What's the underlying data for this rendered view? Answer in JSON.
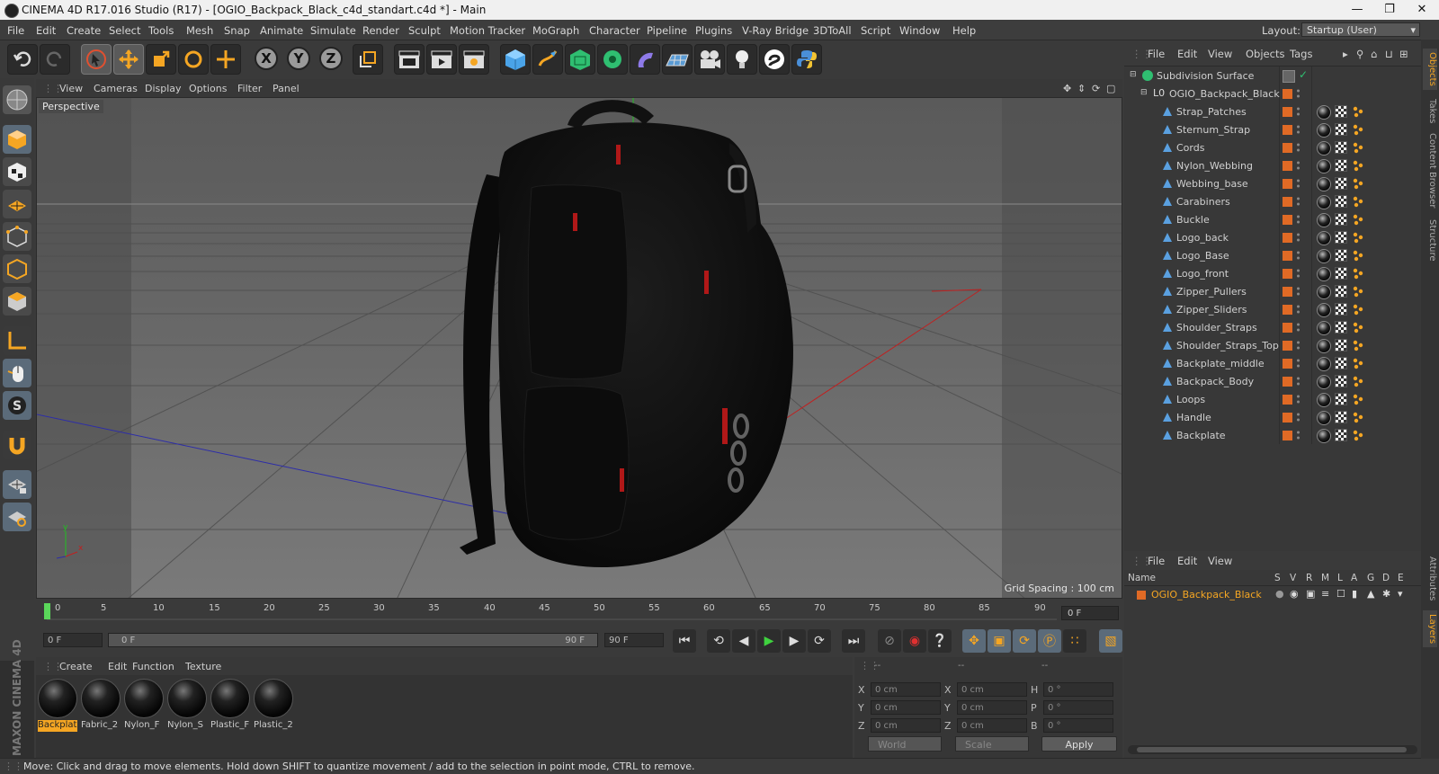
{
  "window": {
    "title": "CINEMA 4D R17.016 Studio (R17) - [OGIO_Backpack_Black_c4d_standart.c4d *] - Main",
    "buttons": [
      "—",
      "❐",
      "✕"
    ]
  },
  "menubar": {
    "items": [
      "File",
      "Edit",
      "Create",
      "Select",
      "Tools",
      "Mesh",
      "Snap",
      "Animate",
      "Simulate",
      "Render",
      "Sculpt",
      "Motion Tracker",
      "MoGraph",
      "Character",
      "Pipeline",
      "Plugins",
      "V-Ray Bridge",
      "3DToAll",
      "Script",
      "Window",
      "Help"
    ],
    "layout_label": "Layout:",
    "layout_value": "Startup (User)"
  },
  "toolbar": {
    "axes": [
      "X",
      "Y",
      "Z"
    ]
  },
  "viewport": {
    "menu": [
      "View",
      "Cameras",
      "Display",
      "Options",
      "Filter",
      "Panel"
    ],
    "camera_label": "Perspective",
    "grid_spacing": "Grid Spacing : 100 cm"
  },
  "timeline": {
    "ticks": [
      "0",
      "5",
      "10",
      "15",
      "20",
      "25",
      "30",
      "35",
      "40",
      "45",
      "50",
      "55",
      "60",
      "65",
      "70",
      "75",
      "80",
      "85",
      "90"
    ],
    "current_frame": "0 F",
    "start_frame": "0 F",
    "range_start": "0 F",
    "range_end": "90 F",
    "end_frame": "90 F"
  },
  "material_manager": {
    "menu": [
      "Create",
      "Edit",
      "Function",
      "Texture"
    ],
    "materials": [
      "Backplat",
      "Fabric_2",
      "Nylon_F",
      "Nylon_S",
      "Plastic_F",
      "Plastic_2"
    ]
  },
  "coordinates": {
    "header": [
      "--",
      "--",
      "--"
    ],
    "rows": [
      {
        "a": "X",
        "av": "0 cm",
        "b": "X",
        "bv": "0 cm",
        "c": "H",
        "cv": "0 °"
      },
      {
        "a": "Y",
        "av": "0 cm",
        "b": "Y",
        "bv": "0 cm",
        "c": "P",
        "cv": "0 °"
      },
      {
        "a": "Z",
        "av": "0 cm",
        "b": "Z",
        "bv": "0 cm",
        "c": "B",
        "cv": "0 °"
      }
    ],
    "world": "World",
    "scale": "Scale",
    "apply": "Apply"
  },
  "status": "Move: Click and drag to move elements. Hold down SHIFT to quantize movement / add to the selection in point mode, CTRL to remove.",
  "branding": "MAXON CINEMA 4D",
  "object_manager": {
    "menu": [
      "File",
      "Edit",
      "View",
      "Objects",
      "Tags"
    ],
    "root": "Subdivision Surface",
    "group": "OGIO_Backpack_Black",
    "objects": [
      "Strap_Patches",
      "Sternum_Strap",
      "Cords",
      "Nylon_Webbing",
      "Webbing_base",
      "Carabiners",
      "Buckle",
      "Logo_back",
      "Logo_Base",
      "Logo_front",
      "Zipper_Pullers",
      "Zipper_Sliders",
      "Shoulder_Straps",
      "Shoulder_Straps_Top",
      "Backplate_middle",
      "Backpack_Body",
      "Loops",
      "Handle",
      "Backplate"
    ]
  },
  "right_tabs": [
    "Objects",
    "Takes",
    "Content Browser",
    "Structure",
    "Attributes",
    "Layers"
  ],
  "layer_manager": {
    "menu": [
      "File",
      "Edit",
      "View"
    ],
    "columns": [
      "Name",
      "S",
      "V",
      "R",
      "M",
      "L",
      "A",
      "G",
      "D",
      "E"
    ],
    "layer": "OGIO_Backpack_Black"
  },
  "colors": {
    "accent_orange": "#e06a25",
    "timeline_marker": "#5ad75a"
  }
}
